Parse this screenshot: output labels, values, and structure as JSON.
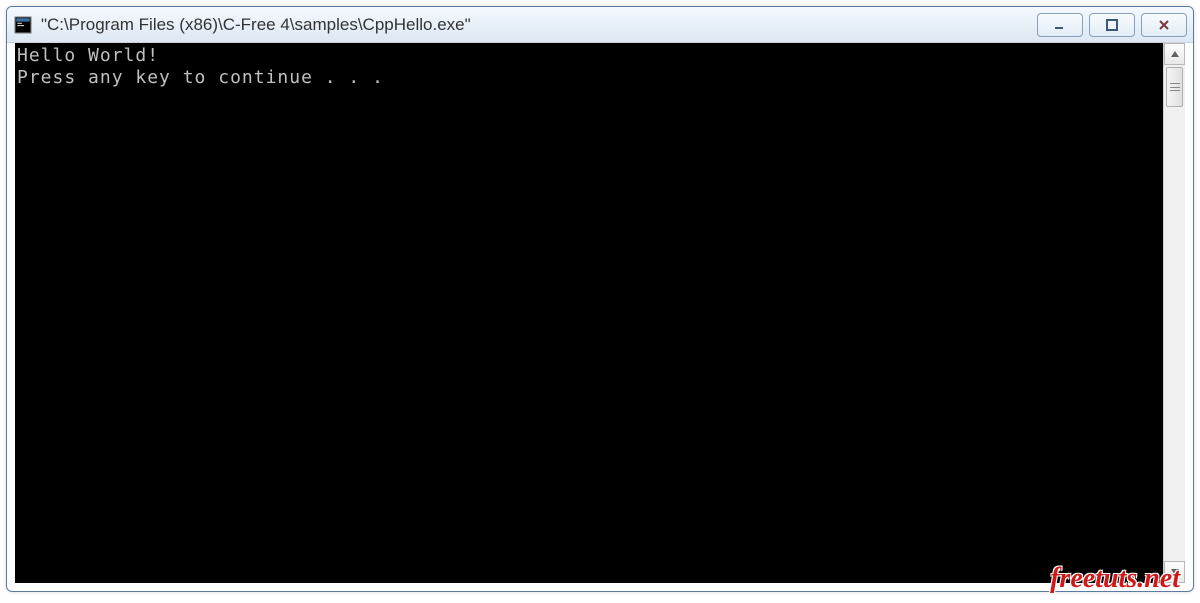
{
  "titlebar": {
    "title": "\"C:\\Program Files (x86)\\C-Free 4\\samples\\CppHello.exe\""
  },
  "console": {
    "lines": [
      "Hello World!",
      "Press any key to continue . . ."
    ]
  },
  "watermark": {
    "text": "freetuts.net"
  }
}
